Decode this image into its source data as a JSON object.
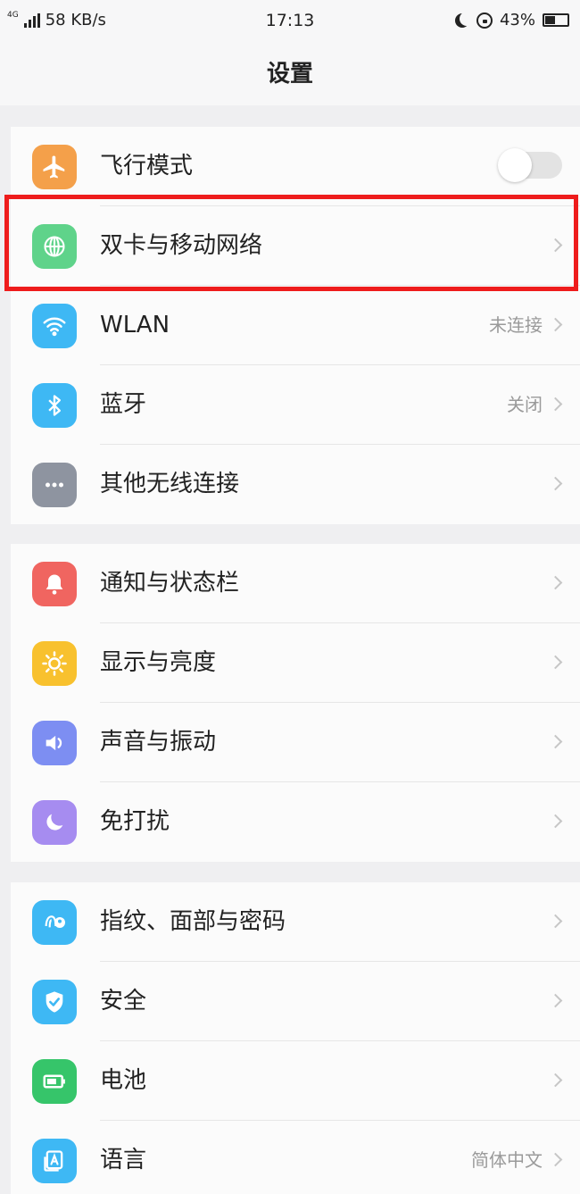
{
  "status_bar": {
    "network_type": "4G",
    "speed": "58 KB/s",
    "time": "17:13",
    "battery": "43%",
    "battery_level": 0.43
  },
  "header": {
    "title": "设置"
  },
  "colors": {
    "airplane": "#f4a04a",
    "network": "#5fd38a",
    "wlan": "#3eb8f4",
    "bluetooth": "#3eb8f4",
    "other_wireless": "#8e94a0",
    "notification": "#f06560",
    "display": "#f8c12e",
    "sound": "#7d8ef2",
    "dnd": "#a68cf0",
    "fingerprint": "#3eb8f4",
    "security": "#3eb8f4",
    "battery_icon": "#36c56a",
    "language": "#3eb8f4",
    "highlight": "#ee1c1c"
  },
  "groups": [
    {
      "items": [
        {
          "label": "飞行模式",
          "icon": "airplane-icon",
          "control": "toggle",
          "toggle_on": false
        },
        {
          "label": "双卡与移动网络",
          "icon": "globe-icon",
          "highlighted": true
        },
        {
          "label": "WLAN",
          "icon": "wifi-icon",
          "value": "未连接"
        },
        {
          "label": "蓝牙",
          "icon": "bluetooth-icon",
          "value": "关闭"
        },
        {
          "label": "其他无线连接",
          "icon": "more-dots-icon"
        }
      ]
    },
    {
      "items": [
        {
          "label": "通知与状态栏",
          "icon": "bell-icon"
        },
        {
          "label": "显示与亮度",
          "icon": "sun-icon"
        },
        {
          "label": "声音与振动",
          "icon": "speaker-icon"
        },
        {
          "label": "免打扰",
          "icon": "moon-icon"
        }
      ]
    },
    {
      "items": [
        {
          "label": "指纹、面部与密码",
          "icon": "fingerprint-face-icon"
        },
        {
          "label": "安全",
          "icon": "shield-icon"
        },
        {
          "label": "电池",
          "icon": "battery-icon"
        },
        {
          "label": "语言",
          "icon": "language-icon",
          "value": "简体中文"
        }
      ]
    }
  ]
}
